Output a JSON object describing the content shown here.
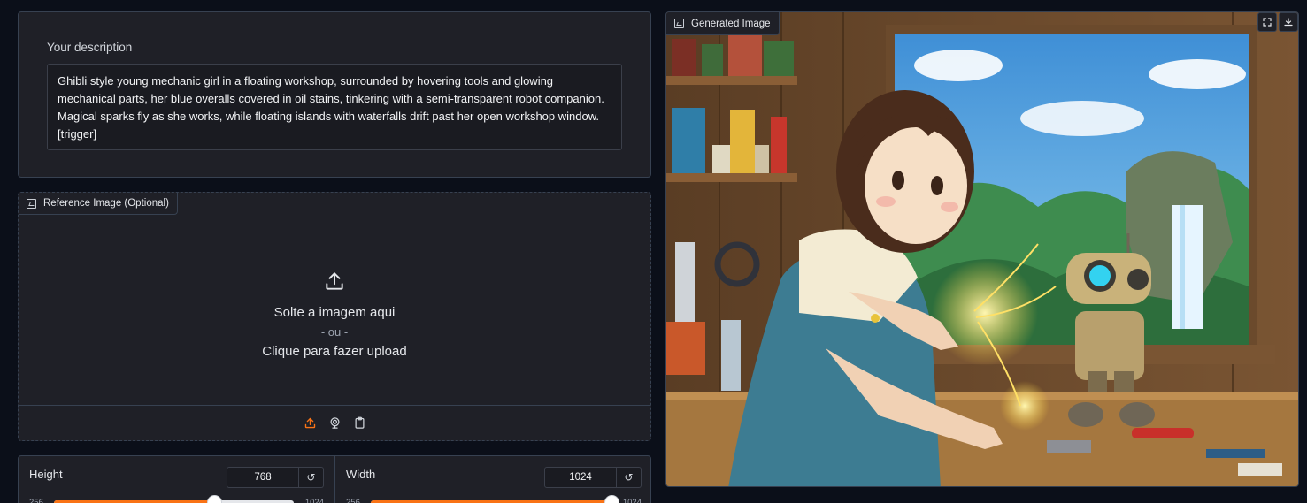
{
  "description": {
    "label": "Your description",
    "value": "Ghibli style young mechanic girl in a floating workshop, surrounded by hovering tools and glowing mechanical parts, her blue overalls covered in oil stains, tinkering with a semi-transparent robot companion. Magical sparks fly as she works, while floating islands with waterfalls drift past her open workshop window. [trigger]"
  },
  "reference_image": {
    "label": "Reference Image (Optional)",
    "drop_text": "Solte a imagem aqui",
    "or_text": "- ou -",
    "click_text": "Clique para fazer upload",
    "sources": [
      "upload-icon",
      "webcam-icon",
      "clipboard-icon"
    ]
  },
  "sliders": {
    "height": {
      "label": "Height",
      "value": "768",
      "min": "256",
      "max": "1024",
      "fraction": 0.667
    },
    "width": {
      "label": "Width",
      "value": "1024",
      "min": "256",
      "max": "1024",
      "fraction": 1.0
    }
  },
  "generated": {
    "label": "Generated Image",
    "tools": [
      "fullscreen-icon",
      "download-icon"
    ]
  },
  "colors": {
    "accent": "#f97316",
    "panel_bg": "#1f2027",
    "page_bg": "#0b0f19",
    "border": "#374151"
  }
}
